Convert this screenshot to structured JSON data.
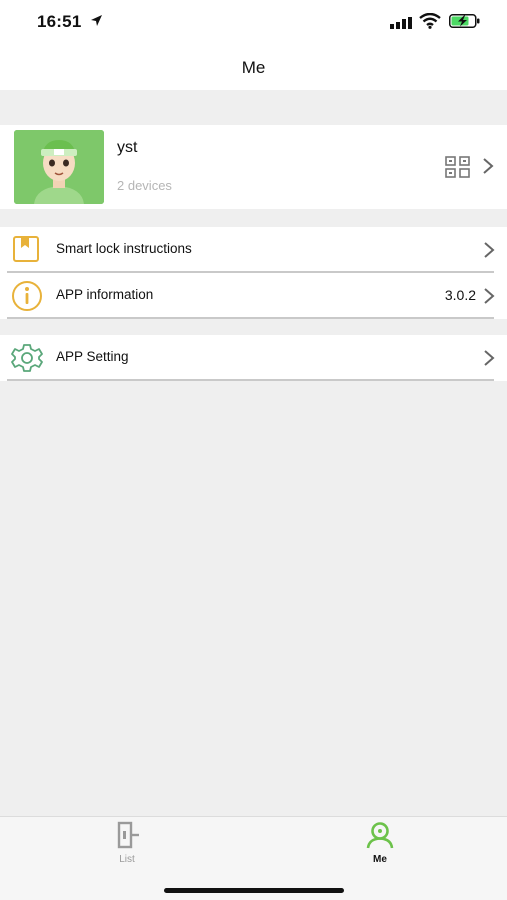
{
  "status_bar": {
    "time": "16:51"
  },
  "nav": {
    "title": "Me"
  },
  "profile": {
    "name": "yst",
    "devices": "2 devices"
  },
  "menu": {
    "smart_lock_instructions": "Smart lock instructions",
    "app_information": "APP information",
    "app_version": "3.0.2",
    "app_setting": "APP Setting"
  },
  "tabs": {
    "list": "List",
    "me": "Me"
  },
  "colors": {
    "accent_green": "#6cc24a",
    "icon_orange": "#e8b23a",
    "setting_green": "#5aa77a"
  }
}
